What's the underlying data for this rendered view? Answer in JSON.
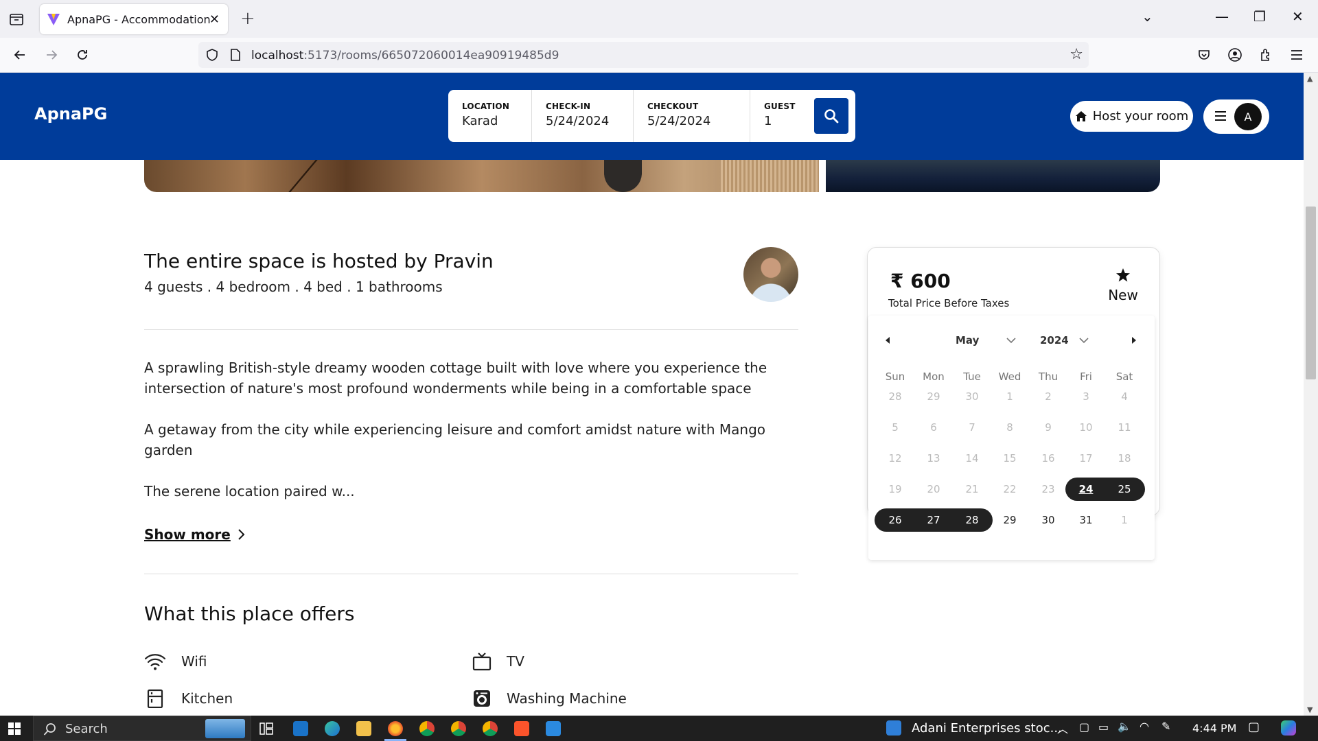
{
  "browser": {
    "tab_title": "ApnaPG - Accommodation Solu",
    "url_host": "localhost",
    "url_path": ":5173/rooms/665072060014ea90919485d9"
  },
  "header": {
    "logo": "ApnaPG",
    "search": {
      "location_label": "LOCATION",
      "location_value": "Karad",
      "checkin_label": "CHECK-IN",
      "checkin_value": "5/24/2024",
      "checkout_label": "CHECKOUT",
      "checkout_value": "5/24/2024",
      "guest_label": "GUEST",
      "guest_value": "1"
    },
    "host_button": "Host your room",
    "avatar_initial": "A"
  },
  "listing": {
    "host_title": "The entire space is hosted by Pravin",
    "host_sub": "4 guests . 4 bedroom . 4 bed . 1 bathrooms",
    "description": [
      "A sprawling British-style dreamy wooden cottage built with love where you experience the intersection of nature's most profound wonderments while being in a comfortable space",
      "A getaway from the city while experiencing leisure and comfort amidst nature with Mango garden",
      "The serene location paired w..."
    ],
    "show_more": "Show more",
    "offers_title": "What this place offers",
    "amenities": [
      {
        "label": "Wifi",
        "icon": "wifi-icon"
      },
      {
        "label": "TV",
        "icon": "tv-icon"
      },
      {
        "label": "Kitchen",
        "icon": "kitchen-icon"
      },
      {
        "label": "Washing Machine",
        "icon": "washing-machine-icon"
      }
    ]
  },
  "booking": {
    "currency": "₹",
    "price": "600",
    "price_sub": "Total Price Before Taxes",
    "badge": "New"
  },
  "calendar": {
    "month": "May",
    "year": "2024",
    "weekdays": [
      "Sun",
      "Mon",
      "Tue",
      "Wed",
      "Thu",
      "Fri",
      "Sat"
    ],
    "weeks": [
      [
        "28",
        "29",
        "30",
        "1",
        "2",
        "3",
        "4"
      ],
      [
        "5",
        "6",
        "7",
        "8",
        "9",
        "10",
        "11"
      ],
      [
        "12",
        "13",
        "14",
        "15",
        "16",
        "17",
        "18"
      ],
      [
        "19",
        "20",
        "21",
        "22",
        "23",
        "24",
        "25"
      ],
      [
        "26",
        "27",
        "28",
        "29",
        "30",
        "31",
        "1"
      ]
    ],
    "selected_start": "24",
    "selected_end": "28"
  },
  "taskbar": {
    "search_label": "Search",
    "news": "Adani Enterprises stoc...",
    "time": "4:44 PM"
  },
  "colors": {
    "brand_blue": "#003c9a",
    "range_dark": "#222222"
  }
}
